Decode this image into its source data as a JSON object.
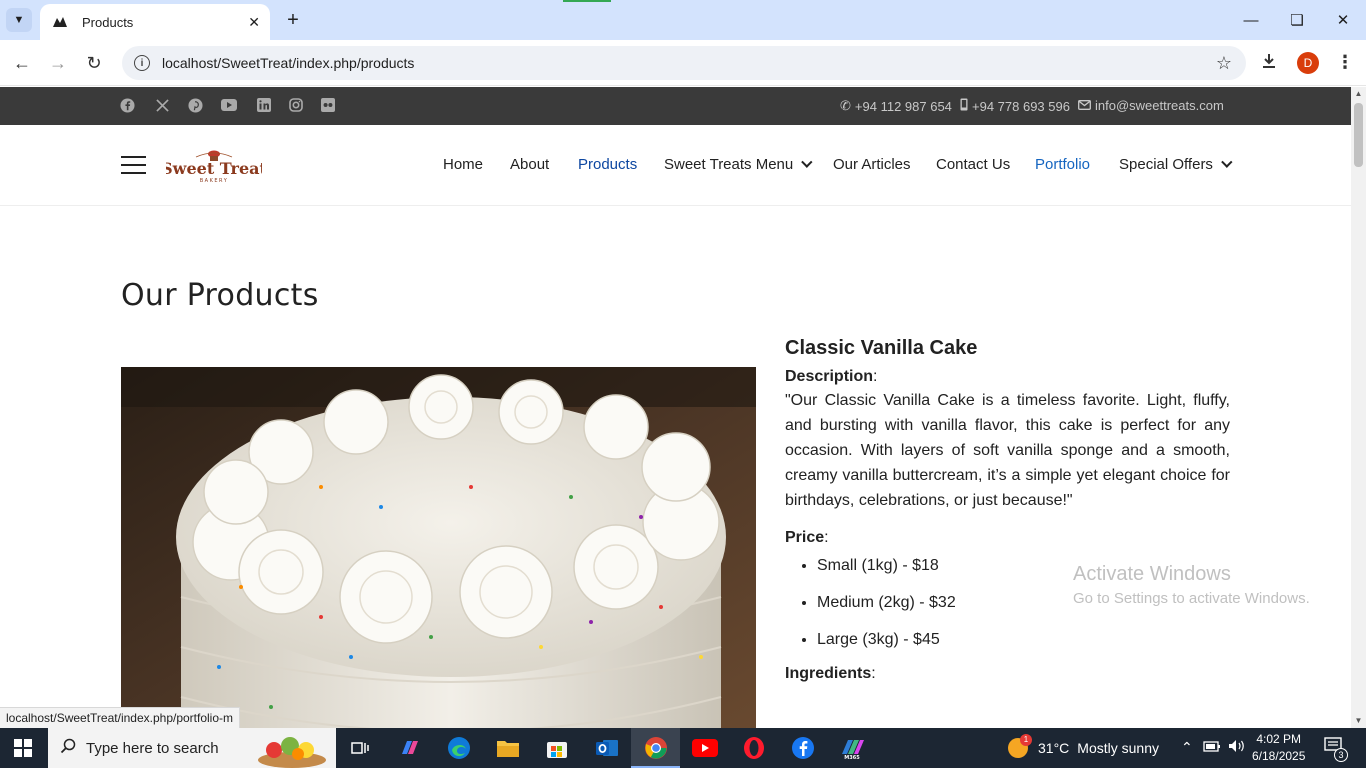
{
  "browser": {
    "tab_title": "Products",
    "url": "localhost/SweetTreat/index.php/products",
    "profile_initial": "D",
    "status_url": "localhost/SweetTreat/index.php/portfolio-m"
  },
  "topbar": {
    "social": [
      "facebook-icon",
      "x-icon",
      "pinterest-icon",
      "youtube-icon",
      "linkedin-icon",
      "instagram-icon",
      "flickr-icon"
    ],
    "phone1": "+94 112 987 654",
    "phone2": "+94 778 693 596",
    "email": "info@sweettreats.com"
  },
  "header": {
    "logo_text": "Sweet Treat",
    "logo_sub": "BAKERY",
    "nav": {
      "home": "Home",
      "about": "About",
      "products": "Products",
      "menu": "Sweet Treats Menu",
      "articles": "Our Articles",
      "contact": "Contact Us",
      "portfolio": "Portfolio",
      "offers": "Special Offers"
    }
  },
  "main": {
    "title": "Our Products",
    "product": {
      "name": "Classic Vanilla Cake",
      "description_label": "Description",
      "description": "\"Our Classic Vanilla Cake is a timeless favorite. Light, fluffy, and bursting with vanilla flavor, this cake is perfect for any occasion. With layers of soft vanilla sponge and a smooth, creamy vanilla buttercream, it’s a simple yet elegant choice for birthdays, celebrations, or just because!\"",
      "price_label": "Price",
      "prices": [
        "Small (1kg) - $18",
        "Medium (2kg) - $32",
        "Large (3kg) - $45"
      ],
      "ingredients_label": "Ingredients"
    }
  },
  "watermark": {
    "title": "Activate Windows",
    "subtitle": "Go to Settings to activate Windows."
  },
  "taskbar": {
    "search_placeholder": "Type here to search",
    "weather_temp": "31°C",
    "weather_desc": "Mostly sunny",
    "weather_badge": "1",
    "time": "4:02 PM",
    "date": "6/18/2025",
    "notifications": "3"
  },
  "colors": {
    "topbar_bg": "#3a3a3a",
    "nav_active": "#0d47a1",
    "tabbar_bg": "#d3e3fd",
    "taskbar_bg": "#1c2633"
  }
}
